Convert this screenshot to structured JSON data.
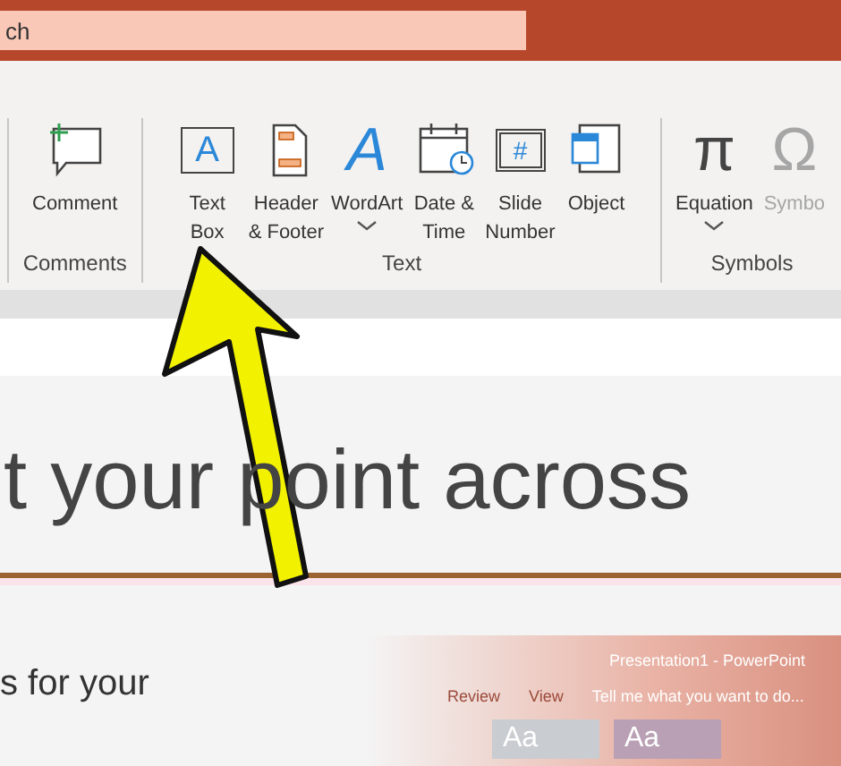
{
  "search": {
    "value": "ch"
  },
  "ribbon": {
    "groups": [
      {
        "label": "Comments",
        "buttons": [
          {
            "lines": [
              "Comment"
            ],
            "has_menu": false,
            "disabled": false
          }
        ]
      },
      {
        "label": "Text",
        "buttons": [
          {
            "glyph": "A",
            "lines": [
              "Text",
              "Box"
            ],
            "has_menu": false,
            "disabled": false
          },
          {
            "lines": [
              "Header",
              "& Footer"
            ],
            "has_menu": false,
            "disabled": false
          },
          {
            "glyph": "A",
            "lines": [
              "WordArt"
            ],
            "has_menu": true,
            "disabled": false
          },
          {
            "lines": [
              "Date &",
              "Time"
            ],
            "has_menu": false,
            "disabled": false
          },
          {
            "glyph": "#",
            "lines": [
              "Slide",
              "Number"
            ],
            "has_menu": false,
            "disabled": false
          },
          {
            "lines": [
              "Object"
            ],
            "has_menu": false,
            "disabled": false
          }
        ]
      },
      {
        "label": "Symbols",
        "buttons": [
          {
            "glyph": "π",
            "lines": [
              "Equation"
            ],
            "has_menu": true,
            "disabled": false
          },
          {
            "glyph": "Ω",
            "lines": [
              "Symbo"
            ],
            "has_menu": false,
            "disabled": true
          }
        ]
      }
    ]
  },
  "slide": {
    "title": "t your point across",
    "body": "s for your",
    "inset": {
      "title": "Presentation1 - PowerPoint",
      "tabs": [
        "Review",
        "View"
      ],
      "tell_me": "Tell me what you want to do...",
      "thumbnails": [
        "Aa",
        "Aa"
      ]
    }
  }
}
